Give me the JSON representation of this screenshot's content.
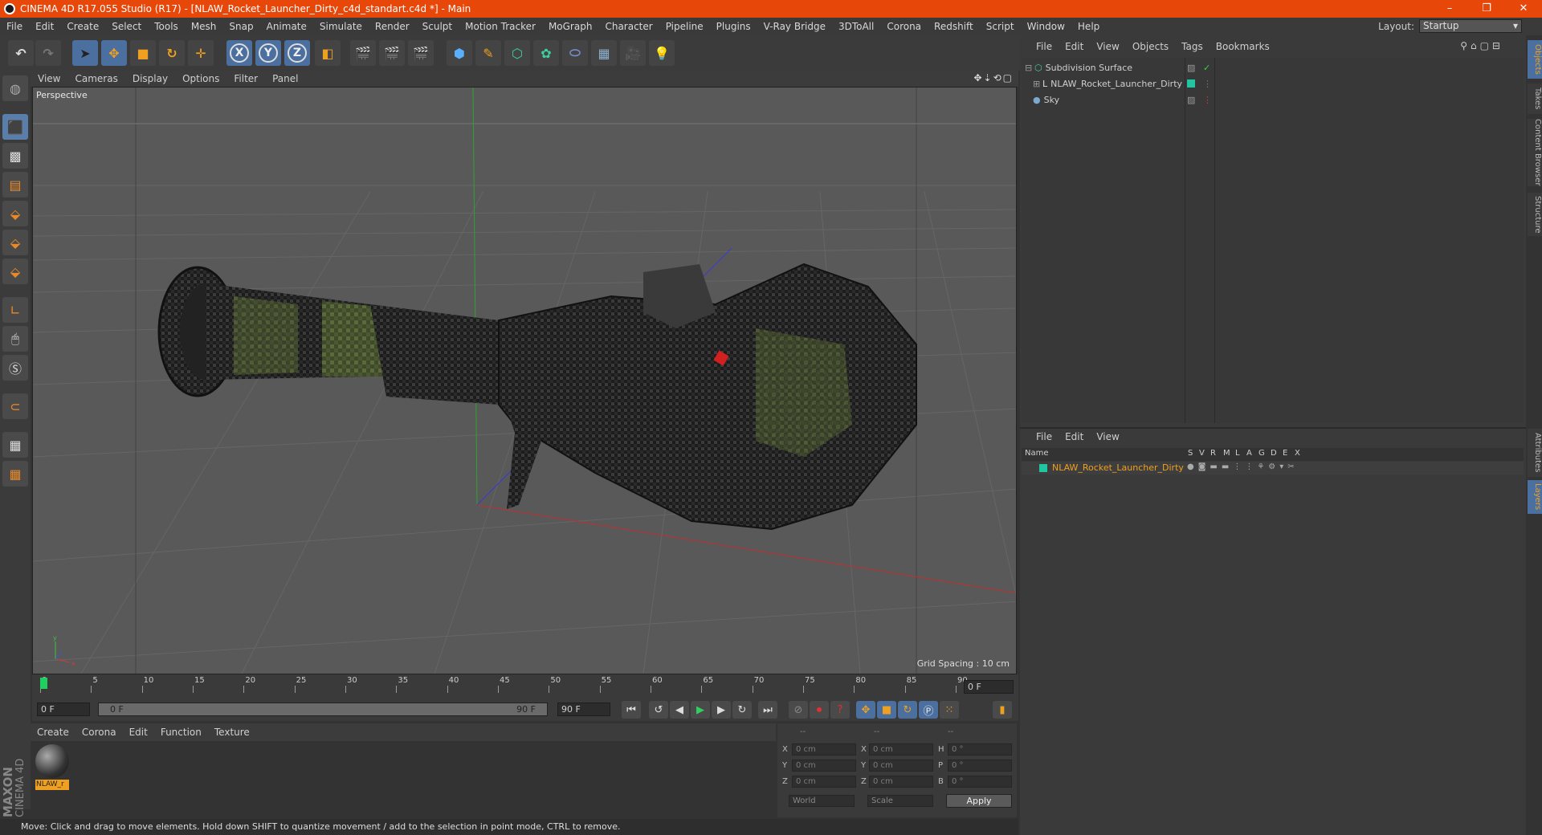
{
  "titlebar": {
    "title": "CINEMA 4D R17.055 Studio (R17) - [NLAW_Rocket_Launcher_Dirty_c4d_standart.c4d *] - Main",
    "minimize": "–",
    "restore": "❐",
    "close": "✕"
  },
  "menubar": {
    "items": [
      "File",
      "Edit",
      "Create",
      "Select",
      "Tools",
      "Mesh",
      "Snap",
      "Animate",
      "Simulate",
      "Render",
      "Sculpt",
      "Motion Tracker",
      "MoGraph",
      "Character",
      "Pipeline",
      "Plugins",
      "V-Ray Bridge",
      "3DToAll",
      "Corona",
      "Redshift",
      "Script",
      "Window",
      "Help"
    ],
    "layout_label": "Layout:",
    "layout_value": "Startup"
  },
  "toolbar": {
    "x_label": "X",
    "y_label": "Y",
    "z_label": "Z"
  },
  "viewport": {
    "menu": [
      "View",
      "Cameras",
      "Display",
      "Options",
      "Filter",
      "Panel"
    ],
    "label": "Perspective",
    "grid_spacing": "Grid Spacing : 10 cm"
  },
  "timeline": {
    "ticks": [
      "0",
      "5",
      "10",
      "15",
      "20",
      "25",
      "30",
      "35",
      "40",
      "45",
      "50",
      "55",
      "60",
      "65",
      "70",
      "75",
      "80",
      "85",
      "90"
    ],
    "current_frame": "0 F",
    "start_frame": "0 F",
    "range_start": "0 F",
    "range_end": "90 F",
    "end_frame": "90 F"
  },
  "materials": {
    "menu": [
      "Create",
      "Corona",
      "Edit",
      "Function",
      "Texture"
    ],
    "items": [
      {
        "label": "NLAW_r"
      }
    ]
  },
  "coordinates": {
    "header": [
      "--",
      "--",
      "--"
    ],
    "rows": [
      {
        "l1": "X",
        "v1": "0 cm",
        "l2": "X",
        "v2": "0 cm",
        "l3": "H",
        "v3": "0 °"
      },
      {
        "l1": "Y",
        "v1": "0 cm",
        "l2": "Y",
        "v2": "0 cm",
        "l3": "P",
        "v3": "0 °"
      },
      {
        "l1": "Z",
        "v1": "0 cm",
        "l2": "Z",
        "v2": "0 cm",
        "l3": "B",
        "v3": "0 °"
      }
    ],
    "mode": "World",
    "scale": "Scale",
    "apply": "Apply"
  },
  "status": "Move: Click and drag to move elements. Hold down SHIFT to quantize movement / add to the selection in point mode, CTRL to remove.",
  "objects": {
    "menu": [
      "File",
      "Edit",
      "View",
      "Objects",
      "Tags",
      "Bookmarks"
    ],
    "rows": [
      {
        "name": "Subdivision Surface"
      },
      {
        "name": "NLAW_Rocket_Launcher_Dirty"
      },
      {
        "name": "Sky"
      }
    ]
  },
  "layers": {
    "menu": [
      "File",
      "Edit",
      "View"
    ],
    "columns": [
      "Name",
      "S",
      "V",
      "R",
      "M",
      "L",
      "A",
      "G",
      "D",
      "E",
      "X"
    ],
    "rows": [
      {
        "name": "NLAW_Rocket_Launcher_Dirty",
        "color": "#1fc6a0"
      }
    ]
  },
  "side_tabs": [
    "Objects",
    "Takes",
    "Content Browser",
    "Structure",
    "Attributes",
    "Layers"
  ],
  "brand": {
    "line1": "MAXON",
    "line2": "CINEMA 4D"
  },
  "colors": {
    "titlebar": "#e8470a",
    "accent": "#4b6f9e",
    "layer_name": "#f0a020"
  }
}
